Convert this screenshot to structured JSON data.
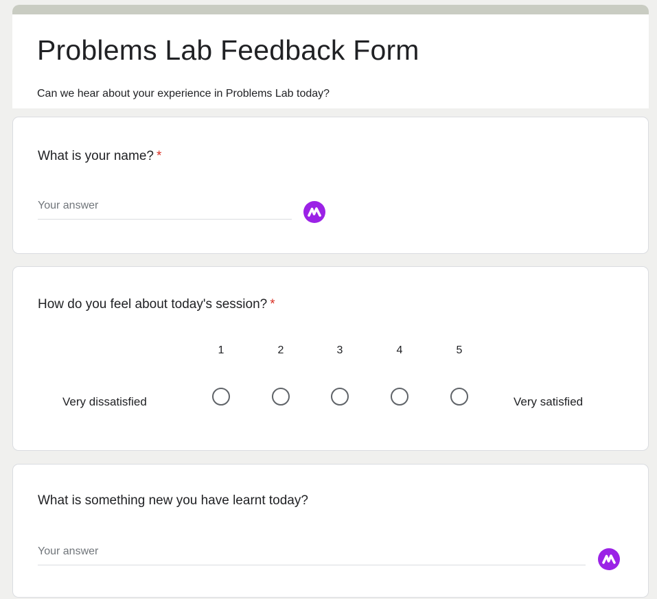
{
  "form": {
    "title": "Problems Lab Feedback Form",
    "description": "Can we hear about your experience in Problems Lab today?"
  },
  "questions": [
    {
      "title": "What is your name?",
      "required_mark": "*",
      "placeholder": "Your answer"
    },
    {
      "title": "How do you feel about today's session?",
      "required_mark": "*",
      "scale": [
        "1",
        "2",
        "3",
        "4",
        "5"
      ],
      "low_label": "Very dissatisfied",
      "high_label": "Very satisfied"
    },
    {
      "title": "What is something new you have learnt today?",
      "placeholder": "Your answer"
    }
  ],
  "colors": {
    "accent_bar": "#c9ccc2",
    "required": "#d93025",
    "extension_icon": "#9b22e6"
  },
  "icons": {
    "extension": "m-logo-icon"
  }
}
